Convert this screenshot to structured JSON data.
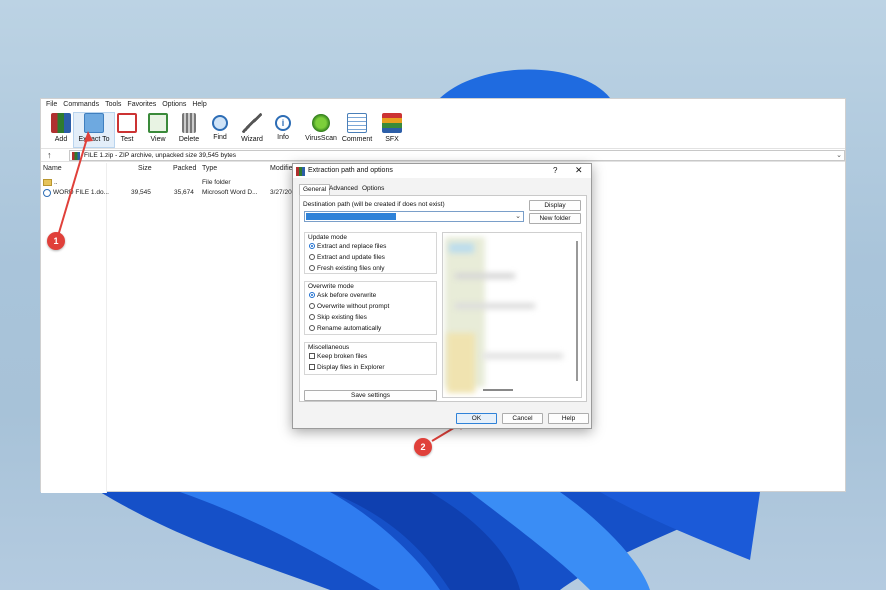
{
  "colors": {
    "accent": "#2f82d8",
    "callout": "#e0403a",
    "wallpaper_blue": "#1a5fd6"
  },
  "menubar": [
    "File",
    "Commands",
    "Tools",
    "Favorites",
    "Options",
    "Help"
  ],
  "toolbar": [
    {
      "label": "Add",
      "icon": "add-archive-icon"
    },
    {
      "label": "Extract To",
      "icon": "extract-folder-icon"
    },
    {
      "label": "Test",
      "icon": "test-icon"
    },
    {
      "label": "View",
      "icon": "view-book-icon"
    },
    {
      "label": "Delete",
      "icon": "trash-icon"
    },
    {
      "label": "Find",
      "icon": "magnifier-icon"
    },
    {
      "label": "Wizard",
      "icon": "wand-icon"
    },
    {
      "label": "Info",
      "icon": "info-icon"
    },
    {
      "label": "VirusScan",
      "icon": "virus-scan-icon"
    },
    {
      "label": "Comment",
      "icon": "comment-icon"
    },
    {
      "label": "SFX",
      "icon": "sfx-books-icon"
    }
  ],
  "address": {
    "text": "FILE 1.zip - ZIP archive, unpacked size 39,545 bytes"
  },
  "columns": {
    "name": "Name",
    "size": "Size",
    "packed": "Packed",
    "type": "Type",
    "modified": "Modifie"
  },
  "files": [
    {
      "name": "..",
      "size": "",
      "packed": "",
      "type": "File folder",
      "modified": ""
    },
    {
      "name": "WORD FILE 1.do...",
      "size": "39,545",
      "packed": "35,674",
      "type": "Microsoft Word D...",
      "modified": "3/27/20"
    }
  ],
  "dialog": {
    "title": "Extraction path and options",
    "help": "?",
    "close": "✕",
    "tabs": [
      "General",
      "Advanced",
      "Options"
    ],
    "dest_label": "Destination path (will be created if does not exist)",
    "display_button": "Display",
    "new_folder_button": "New folder",
    "update_mode": {
      "title": "Update mode",
      "options": [
        "Extract and replace files",
        "Extract and update files",
        "Fresh existing files only"
      ],
      "selected": 0
    },
    "overwrite_mode": {
      "title": "Overwrite mode",
      "options": [
        "Ask before overwrite",
        "Overwrite without prompt",
        "Skip existing files",
        "Rename automatically"
      ],
      "selected": 0
    },
    "misc": {
      "title": "Miscellaneous",
      "options": [
        "Keep broken files",
        "Display files in Explorer"
      ]
    },
    "save_settings": "Save settings",
    "ok": "OK",
    "cancel": "Cancel",
    "help_button": "Help"
  },
  "callouts": [
    "1",
    "2"
  ]
}
